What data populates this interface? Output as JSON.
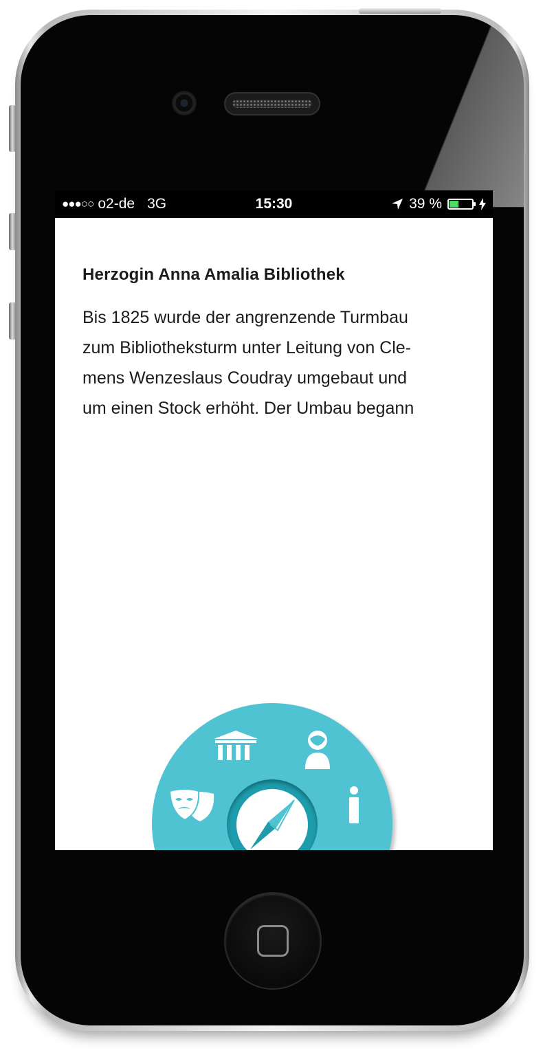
{
  "status_bar": {
    "signal": "●●●○○",
    "carrier": "o2-de",
    "network": "3G",
    "time": "15:30",
    "battery_percent_text": "39 %",
    "battery_level": 0.39,
    "location_icon": "location-arrow-icon",
    "charging_icon": "charging-bolt-icon"
  },
  "article": {
    "title": "Herzogin Anna Amalia Bibliothek",
    "lines": [
      "Bis 1825 wurde der angrenzende Turmbau",
      "zum Bibliotheksturm unter Leitung von Cle-",
      "mens Wenzeslaus Coudray umgebaut und",
      "um einen Stock erhöht. Der Umbau begann"
    ]
  },
  "menu": {
    "items": [
      {
        "icon": "theater-masks-icon"
      },
      {
        "icon": "museum-icon"
      },
      {
        "icon": "person-icon"
      },
      {
        "icon": "info-icon"
      }
    ],
    "center_icon": "compass-icon",
    "accent_color": "#4fc3d1",
    "ring_color": "#1d9cac"
  },
  "device": {
    "home_button_icon": "home-square-icon"
  }
}
